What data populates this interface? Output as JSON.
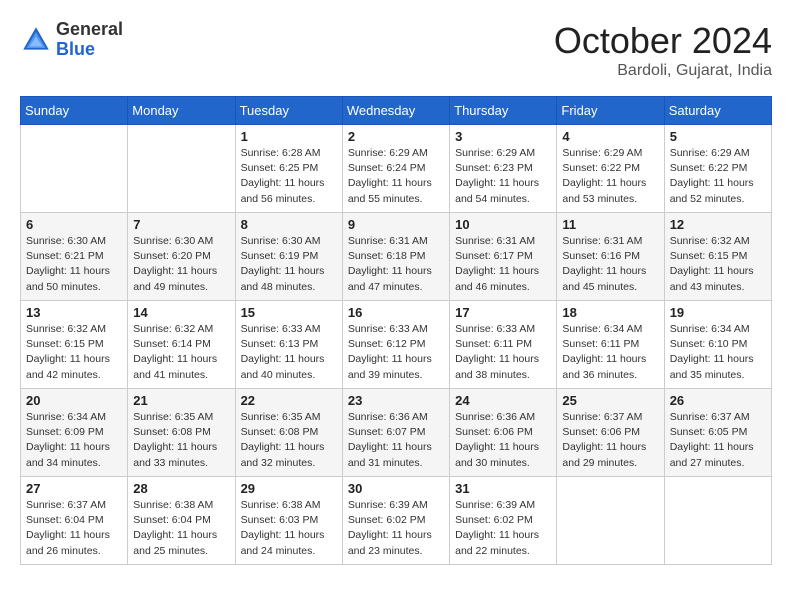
{
  "logo": {
    "general": "General",
    "blue": "Blue"
  },
  "title": "October 2024",
  "location": "Bardoli, Gujarat, India",
  "days_of_week": [
    "Sunday",
    "Monday",
    "Tuesday",
    "Wednesday",
    "Thursday",
    "Friday",
    "Saturday"
  ],
  "weeks": [
    [
      {
        "day": "",
        "sunrise": "",
        "sunset": "",
        "daylight": ""
      },
      {
        "day": "",
        "sunrise": "",
        "sunset": "",
        "daylight": ""
      },
      {
        "day": "1",
        "sunrise": "Sunrise: 6:28 AM",
        "sunset": "Sunset: 6:25 PM",
        "daylight": "Daylight: 11 hours and 56 minutes."
      },
      {
        "day": "2",
        "sunrise": "Sunrise: 6:29 AM",
        "sunset": "Sunset: 6:24 PM",
        "daylight": "Daylight: 11 hours and 55 minutes."
      },
      {
        "day": "3",
        "sunrise": "Sunrise: 6:29 AM",
        "sunset": "Sunset: 6:23 PM",
        "daylight": "Daylight: 11 hours and 54 minutes."
      },
      {
        "day": "4",
        "sunrise": "Sunrise: 6:29 AM",
        "sunset": "Sunset: 6:22 PM",
        "daylight": "Daylight: 11 hours and 53 minutes."
      },
      {
        "day": "5",
        "sunrise": "Sunrise: 6:29 AM",
        "sunset": "Sunset: 6:22 PM",
        "daylight": "Daylight: 11 hours and 52 minutes."
      }
    ],
    [
      {
        "day": "6",
        "sunrise": "Sunrise: 6:30 AM",
        "sunset": "Sunset: 6:21 PM",
        "daylight": "Daylight: 11 hours and 50 minutes."
      },
      {
        "day": "7",
        "sunrise": "Sunrise: 6:30 AM",
        "sunset": "Sunset: 6:20 PM",
        "daylight": "Daylight: 11 hours and 49 minutes."
      },
      {
        "day": "8",
        "sunrise": "Sunrise: 6:30 AM",
        "sunset": "Sunset: 6:19 PM",
        "daylight": "Daylight: 11 hours and 48 minutes."
      },
      {
        "day": "9",
        "sunrise": "Sunrise: 6:31 AM",
        "sunset": "Sunset: 6:18 PM",
        "daylight": "Daylight: 11 hours and 47 minutes."
      },
      {
        "day": "10",
        "sunrise": "Sunrise: 6:31 AM",
        "sunset": "Sunset: 6:17 PM",
        "daylight": "Daylight: 11 hours and 46 minutes."
      },
      {
        "day": "11",
        "sunrise": "Sunrise: 6:31 AM",
        "sunset": "Sunset: 6:16 PM",
        "daylight": "Daylight: 11 hours and 45 minutes."
      },
      {
        "day": "12",
        "sunrise": "Sunrise: 6:32 AM",
        "sunset": "Sunset: 6:15 PM",
        "daylight": "Daylight: 11 hours and 43 minutes."
      }
    ],
    [
      {
        "day": "13",
        "sunrise": "Sunrise: 6:32 AM",
        "sunset": "Sunset: 6:15 PM",
        "daylight": "Daylight: 11 hours and 42 minutes."
      },
      {
        "day": "14",
        "sunrise": "Sunrise: 6:32 AM",
        "sunset": "Sunset: 6:14 PM",
        "daylight": "Daylight: 11 hours and 41 minutes."
      },
      {
        "day": "15",
        "sunrise": "Sunrise: 6:33 AM",
        "sunset": "Sunset: 6:13 PM",
        "daylight": "Daylight: 11 hours and 40 minutes."
      },
      {
        "day": "16",
        "sunrise": "Sunrise: 6:33 AM",
        "sunset": "Sunset: 6:12 PM",
        "daylight": "Daylight: 11 hours and 39 minutes."
      },
      {
        "day": "17",
        "sunrise": "Sunrise: 6:33 AM",
        "sunset": "Sunset: 6:11 PM",
        "daylight": "Daylight: 11 hours and 38 minutes."
      },
      {
        "day": "18",
        "sunrise": "Sunrise: 6:34 AM",
        "sunset": "Sunset: 6:11 PM",
        "daylight": "Daylight: 11 hours and 36 minutes."
      },
      {
        "day": "19",
        "sunrise": "Sunrise: 6:34 AM",
        "sunset": "Sunset: 6:10 PM",
        "daylight": "Daylight: 11 hours and 35 minutes."
      }
    ],
    [
      {
        "day": "20",
        "sunrise": "Sunrise: 6:34 AM",
        "sunset": "Sunset: 6:09 PM",
        "daylight": "Daylight: 11 hours and 34 minutes."
      },
      {
        "day": "21",
        "sunrise": "Sunrise: 6:35 AM",
        "sunset": "Sunset: 6:08 PM",
        "daylight": "Daylight: 11 hours and 33 minutes."
      },
      {
        "day": "22",
        "sunrise": "Sunrise: 6:35 AM",
        "sunset": "Sunset: 6:08 PM",
        "daylight": "Daylight: 11 hours and 32 minutes."
      },
      {
        "day": "23",
        "sunrise": "Sunrise: 6:36 AM",
        "sunset": "Sunset: 6:07 PM",
        "daylight": "Daylight: 11 hours and 31 minutes."
      },
      {
        "day": "24",
        "sunrise": "Sunrise: 6:36 AM",
        "sunset": "Sunset: 6:06 PM",
        "daylight": "Daylight: 11 hours and 30 minutes."
      },
      {
        "day": "25",
        "sunrise": "Sunrise: 6:37 AM",
        "sunset": "Sunset: 6:06 PM",
        "daylight": "Daylight: 11 hours and 29 minutes."
      },
      {
        "day": "26",
        "sunrise": "Sunrise: 6:37 AM",
        "sunset": "Sunset: 6:05 PM",
        "daylight": "Daylight: 11 hours and 27 minutes."
      }
    ],
    [
      {
        "day": "27",
        "sunrise": "Sunrise: 6:37 AM",
        "sunset": "Sunset: 6:04 PM",
        "daylight": "Daylight: 11 hours and 26 minutes."
      },
      {
        "day": "28",
        "sunrise": "Sunrise: 6:38 AM",
        "sunset": "Sunset: 6:04 PM",
        "daylight": "Daylight: 11 hours and 25 minutes."
      },
      {
        "day": "29",
        "sunrise": "Sunrise: 6:38 AM",
        "sunset": "Sunset: 6:03 PM",
        "daylight": "Daylight: 11 hours and 24 minutes."
      },
      {
        "day": "30",
        "sunrise": "Sunrise: 6:39 AM",
        "sunset": "Sunset: 6:02 PM",
        "daylight": "Daylight: 11 hours and 23 minutes."
      },
      {
        "day": "31",
        "sunrise": "Sunrise: 6:39 AM",
        "sunset": "Sunset: 6:02 PM",
        "daylight": "Daylight: 11 hours and 22 minutes."
      },
      {
        "day": "",
        "sunrise": "",
        "sunset": "",
        "daylight": ""
      },
      {
        "day": "",
        "sunrise": "",
        "sunset": "",
        "daylight": ""
      }
    ]
  ]
}
